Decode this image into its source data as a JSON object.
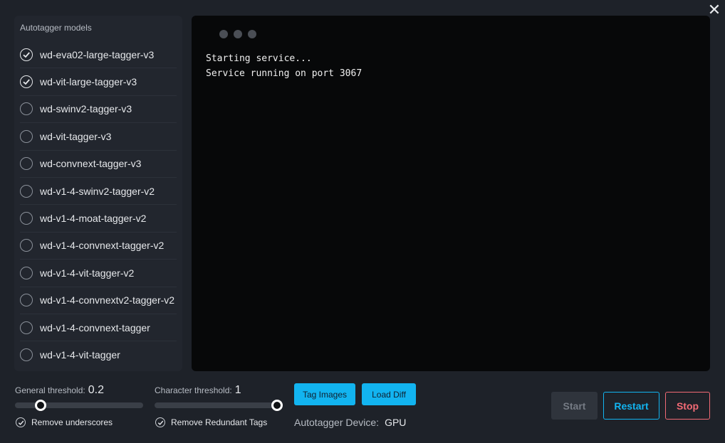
{
  "window": {
    "close_icon": "close-icon"
  },
  "models": {
    "title": "Autotagger models",
    "items": [
      {
        "label": "wd-eva02-large-tagger-v3",
        "checked": true
      },
      {
        "label": "wd-vit-large-tagger-v3",
        "checked": true
      },
      {
        "label": "wd-swinv2-tagger-v3",
        "checked": false
      },
      {
        "label": "wd-vit-tagger-v3",
        "checked": false
      },
      {
        "label": "wd-convnext-tagger-v3",
        "checked": false
      },
      {
        "label": "wd-v1-4-swinv2-tagger-v2",
        "checked": false
      },
      {
        "label": "wd-v1-4-moat-tagger-v2",
        "checked": false
      },
      {
        "label": "wd-v1-4-convnext-tagger-v2",
        "checked": false
      },
      {
        "label": "wd-v1-4-vit-tagger-v2",
        "checked": false
      },
      {
        "label": "wd-v1-4-convnextv2-tagger-v2",
        "checked": false
      },
      {
        "label": "wd-v1-4-convnext-tagger",
        "checked": false
      },
      {
        "label": "wd-v1-4-vit-tagger",
        "checked": false
      }
    ]
  },
  "terminal": {
    "lines": [
      "Starting service...",
      "Service running on port 3067"
    ]
  },
  "general_threshold": {
    "label": "General threshold:",
    "value": "0.2",
    "fraction": 0.2
  },
  "character_threshold": {
    "label": "Character threshold:",
    "value": "1",
    "fraction": 1.0
  },
  "options": {
    "remove_underscores": {
      "label": "Remove underscores",
      "checked": true
    },
    "remove_redundant": {
      "label": "Remove Redundant Tags",
      "checked": true
    }
  },
  "buttons": {
    "tag_images": "Tag Images",
    "load_diff": "Load Diff",
    "start": "Start",
    "restart": "Restart",
    "stop": "Stop"
  },
  "device": {
    "label": "Autotagger Device:",
    "value": "GPU"
  },
  "colors": {
    "accent": "#12b4f0",
    "danger": "#f26a75",
    "background": "#1e2229",
    "terminal": "#070809"
  }
}
